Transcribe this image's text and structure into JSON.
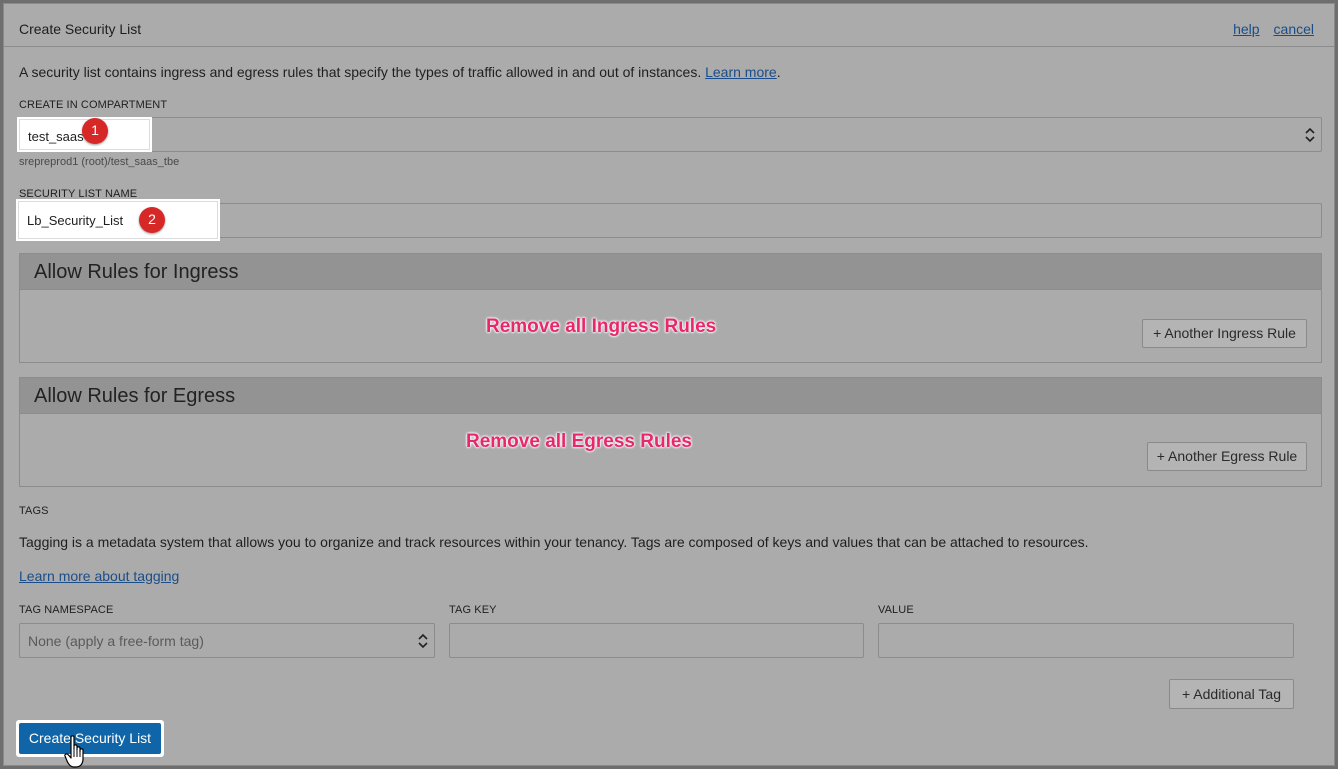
{
  "dialog": {
    "title": "Create Security List",
    "help_link": "help",
    "cancel_link": "cancel"
  },
  "intro": {
    "text": "A security list contains ingress and egress rules that specify the types of traffic allowed in and out of instances.",
    "learn_more": "Learn more",
    "trailing": "."
  },
  "compartment": {
    "label": "CREATE IN COMPARTMENT",
    "value": "test_saas",
    "path": "srepreprod1 (root)/test_saas_tbe",
    "step_badge": "1"
  },
  "security_list_name": {
    "label": "SECURITY LIST NAME",
    "value": "Lb_Security_List",
    "step_badge": "2"
  },
  "ingress": {
    "heading": "Allow Rules for Ingress",
    "annotation": "Remove all Ingress Rules",
    "add_button": "+ Another Ingress Rule"
  },
  "egress": {
    "heading": "Allow Rules for Egress",
    "annotation": "Remove all Egress Rules",
    "add_button": "+ Another Egress Rule"
  },
  "tags": {
    "label": "TAGS",
    "description": "Tagging is a metadata system that allows you to organize and track resources within your tenancy. Tags are composed of keys and values that can be attached to resources.",
    "learn_more": "Learn more about tagging",
    "namespace_label": "TAG NAMESPACE",
    "namespace_value": "None (apply a free-form tag)",
    "key_label": "TAG KEY",
    "key_value": "",
    "value_label": "VALUE",
    "value_value": "",
    "add_button": "+ Additional Tag"
  },
  "footer": {
    "create_button": "Create Security List"
  },
  "colors": {
    "overlay_bg": "#ababab",
    "primary": "#0f65a8",
    "badge": "#d72828",
    "annotation": "#e8286b",
    "link": "#1a4d8a"
  },
  "icons": {
    "select_chevron": "chevron-updown-icon",
    "cursor": "hand-pointer-icon"
  }
}
